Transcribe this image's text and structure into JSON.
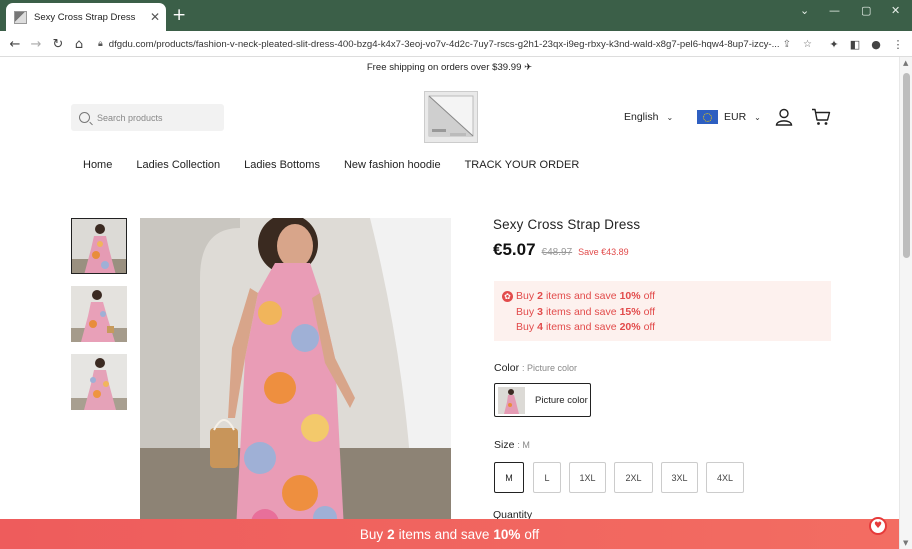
{
  "browser": {
    "tab_title": "Sexy Cross Strap Dress",
    "url": "dfgdu.com/products/fashion-v-neck-pleated-slit-dress-400-bzg4-k4x7-3eoj-vo7v-4d2c-7uy7-rscs-g2h1-23qx-i9eg-rbxy-k3nd-wald-x8g7-pel6-hqw4-8up7-izcy-..."
  },
  "announcement": "Free shipping on orders over $39.99 ✈",
  "header": {
    "search_placeholder": "Search products",
    "language": "English",
    "currency": "EUR"
  },
  "nav": [
    "Home",
    "Ladies Collection",
    "Ladies Bottoms",
    "New fashion hoodie",
    "TRACK YOUR ORDER"
  ],
  "product": {
    "title": "Sexy Cross Strap Dress",
    "price": "€5.07",
    "compare_price": "€48.97",
    "save": "Save €43.89",
    "offers": [
      {
        "pre": "Buy",
        "qty": "2",
        "mid": "items and save",
        "pct": "10%",
        "post": "off"
      },
      {
        "pre": "Buy",
        "qty": "3",
        "mid": "items and save",
        "pct": "15%",
        "post": "off"
      },
      {
        "pre": "Buy",
        "qty": "4",
        "mid": "items and save",
        "pct": "20%",
        "post": "off"
      }
    ],
    "color_label": "Color",
    "color_selected": ": Picture color",
    "color_option": "Picture color",
    "size_label": "Size",
    "size_selected": ": M",
    "sizes": [
      "M",
      "L",
      "1XL",
      "2XL",
      "3XL",
      "4XL"
    ],
    "quantity_label": "Quantity"
  },
  "promo": {
    "pre": "Buy",
    "qty": "2",
    "mid": "items and save",
    "pct": "10%",
    "post": "off"
  }
}
